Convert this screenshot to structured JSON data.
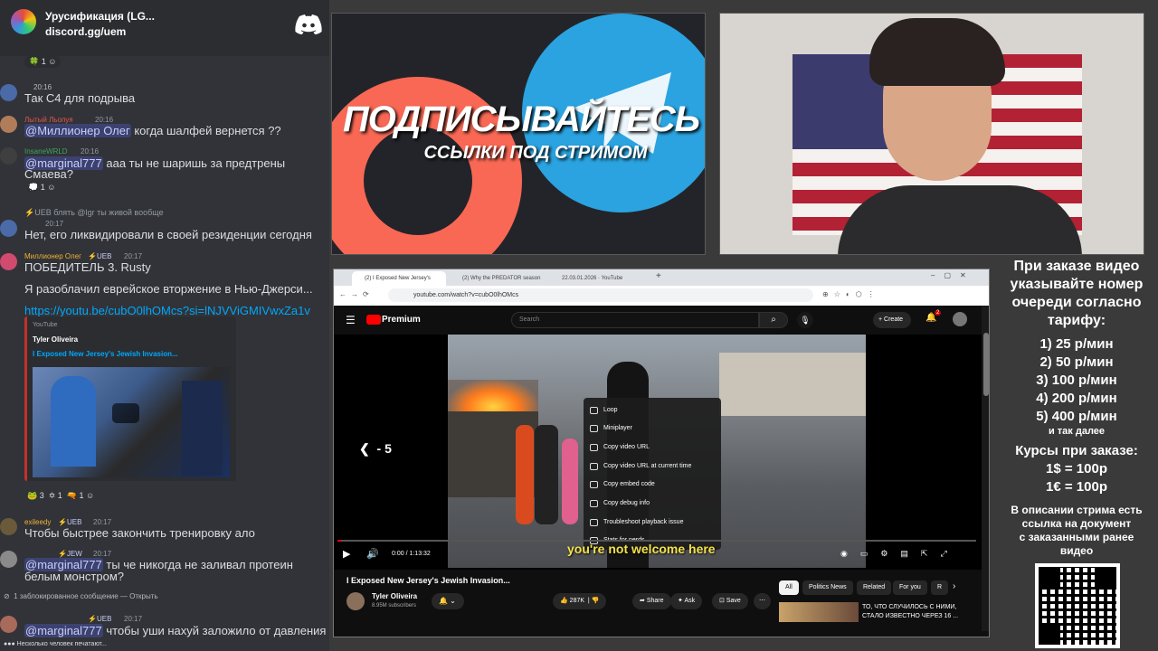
{
  "discord": {
    "server_name": "Урусификация (LG...",
    "invite": "discord.gg/uem",
    "reaction_top": "1",
    "msgs": {
      "m1": {
        "time": "20:16",
        "text": "Так С4 для подрыва"
      },
      "m2": {
        "user": "Лытый Льопуя",
        "time": "20:16",
        "mention": "@Миллионер Олег",
        "text": " когда шалфей вернется ??"
      },
      "m3": {
        "user": "InsaneWRLD",
        "time": "20:16",
        "mention": "@marginal777",
        "text": " ааа ты не шаришь за предтрены",
        "text2": "Смаева?",
        "reaction": "1"
      },
      "m4": {
        "line": "блять @lgr ты живой вообще",
        "tag": "UEB"
      },
      "m5": {
        "time": "20:17",
        "text": "Нет, его ликвидировали в своей резиденции сегодня"
      },
      "m6": {
        "user": "Миллионер Олег",
        "tag": "UEB",
        "time": "20:17",
        "text": "ПОБЕДИТЕЛЬ 3. Rusty",
        "text2": "Я разоблачил еврейское вторжение в Нью-Джерси...",
        "link": "https://youtu.be/cubO0lhOMcs?si=lNJVViGMIVwxZa1v"
      },
      "embed": {
        "site": "YouTube",
        "author": "Tyler Oliveira",
        "title": "I Exposed New Jersey's Jewish Invasion..."
      },
      "reactions": [
        "3",
        "1",
        "1"
      ],
      "m7": {
        "user": "exileedy",
        "tag": "UEB",
        "time": "20:17",
        "text": "Чтобы быстрее закончить тренировку ало"
      },
      "m8": {
        "tag": "JEW",
        "time": "20:17",
        "mention": "@marginal777",
        "text": " ты че никогда не заливал протеин",
        "text2": "белым монстром?"
      },
      "blocked": "1 заблокированное сообщение — ",
      "blocked_link": "Открыть",
      "m9": {
        "tag": "UEB",
        "time": "20:17",
        "mention": "@marginal777",
        "text": " чтобы уши нахуй заложило от давления"
      },
      "typing": "Несколько человек печатают..."
    }
  },
  "promo": {
    "headline": "ПОДПИСЫВАЙТЕСЬ",
    "sub": "ССЫЛКИ ПОД СТРИМОМ"
  },
  "browser": {
    "tabs": [
      "(2) I Exposed New Jersey's",
      "(2) Why the PREDATOR season",
      "22.03.01.2026 · YouTube"
    ],
    "url": "youtube.com/watch?v=cubO0lhOMcs",
    "logo": "Premium",
    "search_placeholder": "Search",
    "create": "Create",
    "notif_count": "2",
    "seek": "- 5",
    "time": "0:00 / 1:13:32",
    "subtitle": "you're not welcome here",
    "context_menu": [
      "Loop",
      "Miniplayer",
      "Copy video URL",
      "Copy video URL at current time",
      "Copy embed code",
      "Copy debug info",
      "Troubleshoot playback issue",
      "Stats for nerds"
    ],
    "video_title": "I Exposed New Jersey's Jewish Invasion...",
    "channel": "Tyler Oliveira",
    "subs": "8.95M subscribers",
    "likes": "287K",
    "share": "Share",
    "ask": "Ask",
    "save": "Save",
    "chips": [
      "All",
      "Politics News",
      "Related",
      "For you",
      "R"
    ],
    "rec_title1": "ТО, ЧТО СЛУЧИЛОСЬ С НИМИ,",
    "rec_title2": "СТАЛО ИЗВЕСТНО ЧЕРЕЗ 16 ..."
  },
  "info": {
    "l1": "При заказе видео",
    "l2": "указывайте номер",
    "l3": "очереди согласно",
    "l4": "тарифу:",
    "tariffs": [
      "1) 25 р/мин",
      "2) 50 р/мин",
      "3) 100 р/мин",
      "4) 200 р/мин",
      "5) 400 р/мин"
    ],
    "more": "и так далее",
    "c1": "Курсы при заказе:",
    "c2": "1$ = 100р",
    "c3": "1€ = 100р",
    "d1": "В описании стрима есть",
    "d2": "ссылка на документ",
    "d3": "с заказанными ранее",
    "d4": "видео"
  },
  "colors": {
    "youtube_red": "#ff0000",
    "discord_bg": "#313338",
    "mention_bg": "#3c4270",
    "link": "#00a8fc",
    "telegram_blue": "#2aa3e0",
    "patreon_orange": "#f96854"
  }
}
